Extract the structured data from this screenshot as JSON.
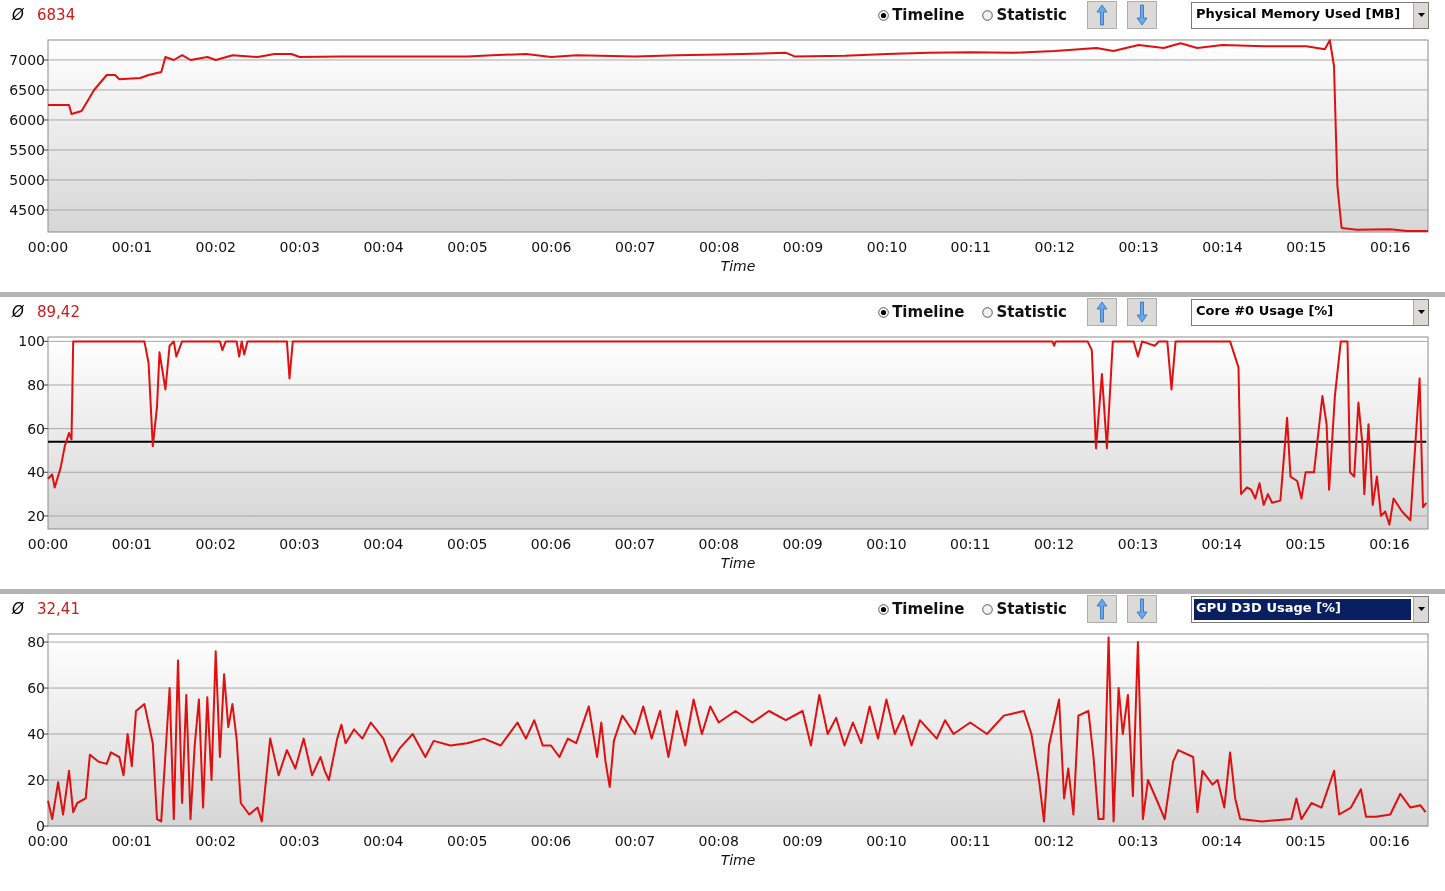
{
  "panels": [
    {
      "average_symbol": "Ø",
      "average": "6834",
      "view_options": [
        {
          "label": "Timeline",
          "selected": true
        },
        {
          "label": "Statistic",
          "selected": false
        }
      ],
      "metric_dropdown": {
        "value": "Physical Memory Used [MB]",
        "focused": false
      },
      "chart_data": {
        "type": "line",
        "xlabel": "Time",
        "xlim": [
          0,
          16.45
        ],
        "ylim": [
          4133,
          7333
        ],
        "yticks": [
          4500,
          5000,
          5500,
          6000,
          6500,
          7000
        ],
        "xticks": [
          {
            "value": 0,
            "label": "00:00"
          },
          {
            "value": 1,
            "label": "00:01"
          },
          {
            "value": 2,
            "label": "00:02"
          },
          {
            "value": 3,
            "label": "00:03"
          },
          {
            "value": 4,
            "label": "00:04"
          },
          {
            "value": 5,
            "label": "00:05"
          },
          {
            "value": 6,
            "label": "00:06"
          },
          {
            "value": 7,
            "label": "00:07"
          },
          {
            "value": 8,
            "label": "00:08"
          },
          {
            "value": 9,
            "label": "00:09"
          },
          {
            "value": 10,
            "label": "00:10"
          },
          {
            "value": 11,
            "label": "00:11"
          },
          {
            "value": 12,
            "label": "00:12"
          },
          {
            "value": 13,
            "label": "00:13"
          },
          {
            "value": 14,
            "label": "00:14"
          },
          {
            "value": 15,
            "label": "00:15"
          },
          {
            "value": 16,
            "label": "00:16"
          }
        ],
        "x": [
          0,
          0.25,
          0.28,
          0.4,
          0.55,
          0.7,
          0.8,
          0.85,
          1.1,
          1.2,
          1.35,
          1.4,
          1.5,
          1.6,
          1.7,
          1.9,
          2.0,
          2.2,
          2.5,
          2.7,
          2.9,
          3.0,
          3.5,
          4.0,
          5.0,
          5.3,
          5.7,
          6.0,
          6.3,
          7.0,
          7.5,
          8.0,
          8.8,
          8.9,
          9.5,
          10,
          10.5,
          11,
          11.5,
          12,
          12.5,
          12.7,
          13,
          13.3,
          13.5,
          13.7,
          14,
          14.5,
          15,
          15.22,
          15.28,
          15.33,
          15.37,
          15.42,
          15.6,
          16,
          16.2,
          16.45
        ],
        "grid": true,
        "series": [
          {
            "color": "#e01010",
            "values": [
              6250,
              6250,
              6100,
              6150,
              6500,
              6750,
              6750,
              6680,
              6700,
              6750,
              6800,
              7050,
              7000,
              7080,
              7000,
              7050,
              7000,
              7080,
              7050,
              7100,
              7100,
              7050,
              7060,
              7060,
              7060,
              7080,
              7100,
              7050,
              7080,
              7060,
              7080,
              7090,
              7120,
              7060,
              7070,
              7100,
              7120,
              7130,
              7120,
              7150,
              7200,
              7150,
              7250,
              7200,
              7280,
              7200,
              7250,
              7230,
              7230,
              7180,
              7330,
              6900,
              4900,
              4200,
              4170,
              4180,
              4150,
              4150
            ]
          }
        ]
      }
    },
    {
      "average_symbol": "Ø",
      "average": "89,42",
      "view_options": [
        {
          "label": "Timeline",
          "selected": true
        },
        {
          "label": "Statistic",
          "selected": false
        }
      ],
      "metric_dropdown": {
        "value": "Core #0 Usage [%]",
        "focused": false
      },
      "chart_data": {
        "type": "line",
        "xlabel": "Time",
        "xlim": [
          0,
          16.46
        ],
        "ylim": [
          14,
          102
        ],
        "yticks": [
          20,
          40,
          60,
          80,
          100
        ],
        "xticks": [
          {
            "value": 0,
            "label": "00:00"
          },
          {
            "value": 1,
            "label": "00:01"
          },
          {
            "value": 2,
            "label": "00:02"
          },
          {
            "value": 3,
            "label": "00:03"
          },
          {
            "value": 4,
            "label": "00:04"
          },
          {
            "value": 5,
            "label": "00:05"
          },
          {
            "value": 6,
            "label": "00:06"
          },
          {
            "value": 7,
            "label": "00:07"
          },
          {
            "value": 8,
            "label": "00:08"
          },
          {
            "value": 9,
            "label": "00:09"
          },
          {
            "value": 10,
            "label": "00:10"
          },
          {
            "value": 11,
            "label": "00:11"
          },
          {
            "value": 12,
            "label": "00:12"
          },
          {
            "value": 13,
            "label": "00:13"
          },
          {
            "value": 14,
            "label": "00:14"
          },
          {
            "value": 15,
            "label": "00:15"
          },
          {
            "value": 16,
            "label": "00:16"
          }
        ],
        "x": [
          0,
          0.05,
          0.08,
          0.15,
          0.2,
          0.25,
          0.28,
          0.3,
          1.15,
          1.2,
          1.25,
          1.3,
          1.33,
          1.4,
          1.45,
          1.5,
          1.53,
          1.6,
          2.05,
          2.08,
          2.12,
          2.25,
          2.28,
          2.31,
          2.34,
          2.38,
          2.85,
          2.88,
          2.92,
          11.98,
          12.0,
          12.02,
          12.4,
          12.45,
          12.5,
          12.57,
          12.63,
          12.7,
          12.95,
          13.0,
          13.05,
          13.2,
          13.25,
          13.35,
          13.4,
          13.45,
          14.1,
          14.2,
          14.23,
          14.3,
          14.35,
          14.4,
          14.45,
          14.5,
          14.55,
          14.6,
          14.7,
          14.78,
          14.82,
          14.9,
          14.95,
          15.0,
          15.1,
          15.2,
          15.25,
          15.28,
          15.35,
          15.42,
          15.5,
          15.53,
          15.58,
          15.63,
          15.68,
          15.7,
          15.75,
          15.8,
          15.85,
          15.9,
          15.95,
          16.0,
          16.05,
          16.15,
          16.25,
          16.36,
          16.4,
          16.44
        ],
        "grid": true,
        "series": [
          {
            "color": "#e01010",
            "values": [
              37,
              39,
              33,
              42,
              52,
              58,
              55,
              100,
              100,
              90,
              52,
              70,
              95,
              78,
              98,
              100,
              93,
              100,
              100,
              96,
              100,
              100,
              93,
              100,
              94,
              100,
              100,
              83,
              100,
              100,
              98,
              100,
              100,
              96,
              51,
              85,
              51,
              100,
              100,
              93,
              100,
              98,
              100,
              100,
              78,
              100,
              100,
              88,
              30,
              33,
              32,
              28,
              35,
              25,
              30,
              26,
              27,
              65,
              38,
              36,
              28,
              40,
              40,
              75,
              62,
              32,
              75,
              100,
              100,
              40,
              38,
              72,
              52,
              30,
              62,
              25,
              38,
              20,
              22,
              16,
              28,
              22,
              18,
              83,
              24,
              26
            ]
          },
          {
            "color": "#000000",
            "values": [
              54,
              54,
              54,
              54,
              54,
              54,
              54,
              54,
              54,
              54,
              54,
              54,
              54,
              54,
              54,
              54,
              54,
              54,
              54,
              54,
              54,
              54,
              54,
              54,
              54,
              54,
              54,
              54,
              54,
              54,
              54,
              54,
              54,
              54,
              54,
              54,
              54,
              54,
              54,
              54,
              54,
              54,
              54,
              54,
              54,
              54,
              54,
              54,
              54,
              54,
              54,
              54,
              54,
              54,
              54,
              54,
              54,
              54,
              54,
              54,
              54,
              54,
              54,
              54,
              54,
              54,
              54,
              54,
              54,
              54,
              54,
              54,
              54,
              54,
              54,
              54,
              54,
              54,
              54,
              54,
              54,
              54,
              54,
              54,
              54,
              54
            ]
          }
        ]
      }
    },
    {
      "average_symbol": "Ø",
      "average": "32,41",
      "view_options": [
        {
          "label": "Timeline",
          "selected": true
        },
        {
          "label": "Statistic",
          "selected": false
        }
      ],
      "metric_dropdown": {
        "value": "GPU D3D Usage [%]",
        "focused": true
      },
      "chart_data": {
        "type": "line",
        "xlabel": "Time",
        "xlim": [
          0,
          16.46
        ],
        "ylim": [
          0,
          83.5
        ],
        "yticks": [
          0,
          20,
          40,
          60,
          80
        ],
        "xticks": [
          {
            "value": 0,
            "label": "00:00"
          },
          {
            "value": 1,
            "label": "00:01"
          },
          {
            "value": 2,
            "label": "00:02"
          },
          {
            "value": 3,
            "label": "00:03"
          },
          {
            "value": 4,
            "label": "00:04"
          },
          {
            "value": 5,
            "label": "00:05"
          },
          {
            "value": 6,
            "label": "00:06"
          },
          {
            "value": 7,
            "label": "00:07"
          },
          {
            "value": 8,
            "label": "00:08"
          },
          {
            "value": 9,
            "label": "00:09"
          },
          {
            "value": 10,
            "label": "00:10"
          },
          {
            "value": 11,
            "label": "00:11"
          },
          {
            "value": 12,
            "label": "00:12"
          },
          {
            "value": 13,
            "label": "00:13"
          },
          {
            "value": 14,
            "label": "00:14"
          },
          {
            "value": 15,
            "label": "00:15"
          },
          {
            "value": 16,
            "label": "00:16"
          }
        ],
        "x": [
          0,
          0.05,
          0.12,
          0.18,
          0.25,
          0.3,
          0.35,
          0.45,
          0.5,
          0.6,
          0.7,
          0.75,
          0.85,
          0.9,
          0.95,
          1.0,
          1.05,
          1.15,
          1.25,
          1.3,
          1.35,
          1.45,
          1.5,
          1.55,
          1.6,
          1.65,
          1.7,
          1.75,
          1.8,
          1.85,
          1.9,
          1.95,
          2.0,
          2.05,
          2.1,
          2.15,
          2.2,
          2.25,
          2.3,
          2.4,
          2.5,
          2.55,
          2.65,
          2.75,
          2.85,
          2.95,
          3.05,
          3.15,
          3.25,
          3.3,
          3.35,
          3.45,
          3.5,
          3.55,
          3.65,
          3.75,
          3.85,
          4.0,
          4.1,
          4.2,
          4.35,
          4.5,
          4.6,
          4.8,
          5.0,
          5.2,
          5.4,
          5.6,
          5.7,
          5.8,
          5.9,
          6.0,
          6.1,
          6.2,
          6.3,
          6.45,
          6.55,
          6.6,
          6.65,
          6.7,
          6.75,
          6.85,
          7.0,
          7.1,
          7.2,
          7.3,
          7.4,
          7.5,
          7.6,
          7.7,
          7.8,
          7.9,
          8.0,
          8.2,
          8.4,
          8.6,
          8.8,
          9.0,
          9.1,
          9.2,
          9.3,
          9.4,
          9.5,
          9.6,
          9.7,
          9.8,
          9.9,
          10.0,
          10.1,
          10.2,
          10.3,
          10.4,
          10.5,
          10.6,
          10.7,
          10.8,
          11.0,
          11.2,
          11.4,
          11.64,
          11.73,
          11.82,
          11.88,
          11.94,
          12.06,
          12.12,
          12.17,
          12.23,
          12.29,
          12.41,
          12.47,
          12.53,
          12.59,
          12.65,
          12.71,
          12.77,
          12.82,
          12.88,
          12.94,
          13.0,
          13.06,
          13.12,
          13.24,
          13.32,
          13.42,
          13.48,
          13.66,
          13.71,
          13.77,
          13.89,
          13.95,
          14.03,
          14.1,
          14.16,
          14.22,
          14.48,
          14.83,
          14.89,
          14.95,
          15.07,
          15.19,
          15.34,
          15.4,
          15.54,
          15.66,
          15.72,
          15.84,
          16.01,
          16.13,
          16.25,
          16.37,
          16.43
        ],
        "grid": true,
        "series": [
          {
            "color": "#e01010",
            "values": [
              11,
              3,
              19,
              5,
              24,
              6,
              10,
              12,
              31,
              28,
              27,
              32,
              30,
              22,
              40,
              26,
              50,
              53,
              36,
              3,
              2,
              60,
              3,
              72,
              10,
              57,
              3,
              35,
              55,
              8,
              56,
              20,
              76,
              30,
              66,
              43,
              53,
              38,
              10,
              5,
              8,
              2,
              38,
              22,
              33,
              25,
              38,
              22,
              30,
              24,
              20,
              38,
              44,
              36,
              42,
              38,
              45,
              38,
              28,
              34,
              40,
              30,
              37,
              35,
              36,
              38,
              35,
              45,
              38,
              46,
              35,
              35,
              30,
              38,
              36,
              52,
              30,
              45,
              28,
              17,
              37,
              48,
              40,
              52,
              38,
              50,
              30,
              50,
              35,
              55,
              40,
              52,
              45,
              50,
              45,
              50,
              46,
              50,
              35,
              57,
              40,
              47,
              35,
              45,
              36,
              52,
              38,
              55,
              40,
              48,
              35,
              46,
              42,
              38,
              46,
              40,
              45,
              40,
              48,
              50,
              40,
              20,
              2,
              35,
              55,
              12,
              25,
              5,
              48,
              50,
              30,
              3,
              3,
              82,
              2,
              60,
              40,
              57,
              13,
              80,
              3,
              20,
              10,
              3,
              28,
              33,
              30,
              6,
              24,
              18,
              20,
              8,
              32,
              12,
              3,
              2,
              3,
              12,
              3,
              10,
              8,
              24,
              5,
              8,
              16,
              4,
              4,
              5,
              14,
              8,
              9,
              6
            ]
          }
        ]
      }
    }
  ]
}
